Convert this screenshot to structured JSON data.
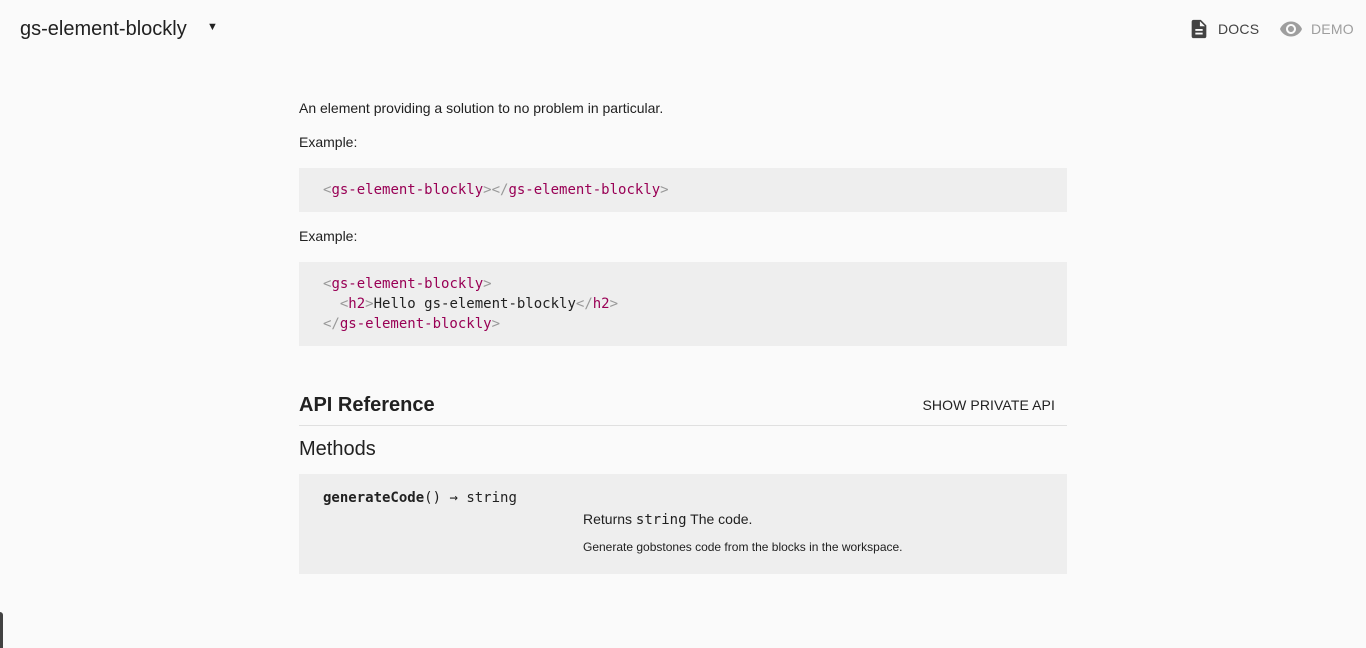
{
  "header": {
    "title": "gs-element-blockly",
    "caret": "▼",
    "docs_label": "DOCS",
    "demo_label": "DEMO",
    "docs_icon": "document-icon",
    "demo_icon": "eye-icon"
  },
  "main": {
    "description": "An element providing a solution to no problem in particular.",
    "examples": [
      {
        "label": "Example:",
        "lines": [
          [
            "<",
            "gs-element-blockly",
            "></",
            "gs-element-blockly",
            ">"
          ]
        ]
      },
      {
        "label": "Example:",
        "lines": [
          [
            "<",
            "gs-element-blockly",
            ">"
          ],
          [
            "  <",
            "h2",
            ">",
            "Hello gs-element-blockly",
            "</",
            "h2",
            ">"
          ],
          [
            "</",
            "gs-element-blockly",
            ">"
          ]
        ]
      }
    ],
    "api": {
      "title": "API Reference",
      "private_button": "SHOW PRIVATE API",
      "methods_title": "Methods",
      "methods": [
        {
          "name": "generateCode",
          "params": "()",
          "arrow": "→",
          "return_type": "string",
          "returns_label": "Returns",
          "returns_type": "string",
          "returns_desc": "The code.",
          "description": "Generate gobstones code from the blocks in the workspace."
        }
      ]
    }
  },
  "colors": {
    "background": "#fafafa",
    "code_background": "#eeeeee",
    "tag_name": "#990055",
    "tag_punct": "#999999",
    "demo_inactive": "#9e9e9e"
  }
}
